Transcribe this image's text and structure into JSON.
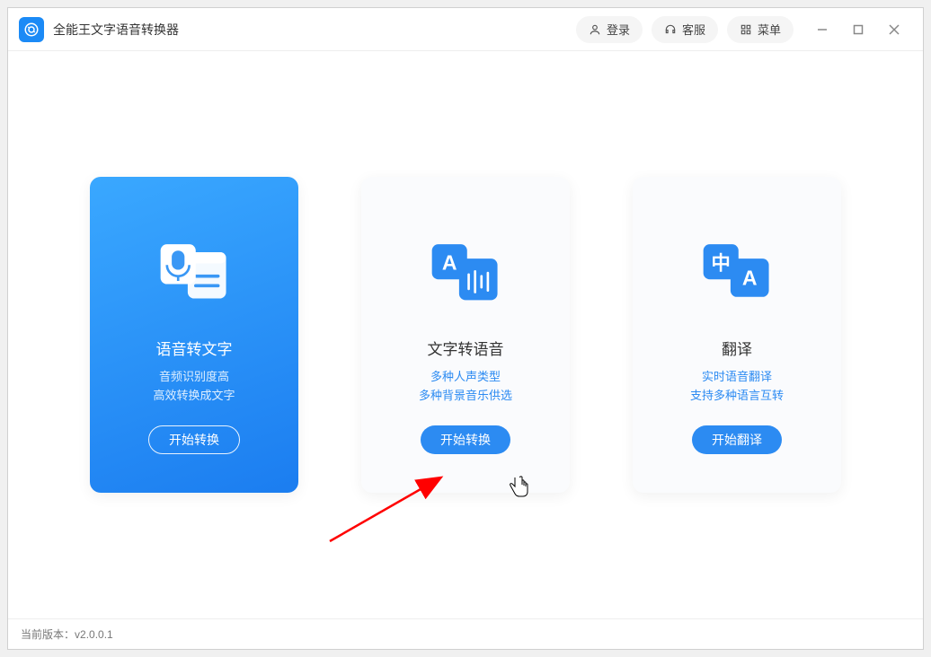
{
  "header": {
    "app_title": "全能王文字语音转换器",
    "login_label": "登录",
    "support_label": "客服",
    "menu_label": "菜单"
  },
  "cards": [
    {
      "title": "语音转文字",
      "desc_line1": "音频识别度高",
      "desc_line2": "高效转换成文字",
      "button": "开始转换"
    },
    {
      "title": "文字转语音",
      "desc_line1": "多种人声类型",
      "desc_line2": "多种背景音乐供选",
      "button": "开始转换"
    },
    {
      "title": "翻译",
      "desc_line1": "实时语音翻译",
      "desc_line2": "支持多种语言互转",
      "button": "开始翻译"
    }
  ],
  "footer": {
    "version_label": "当前版本：",
    "version_value": "v2.0.0.1"
  }
}
